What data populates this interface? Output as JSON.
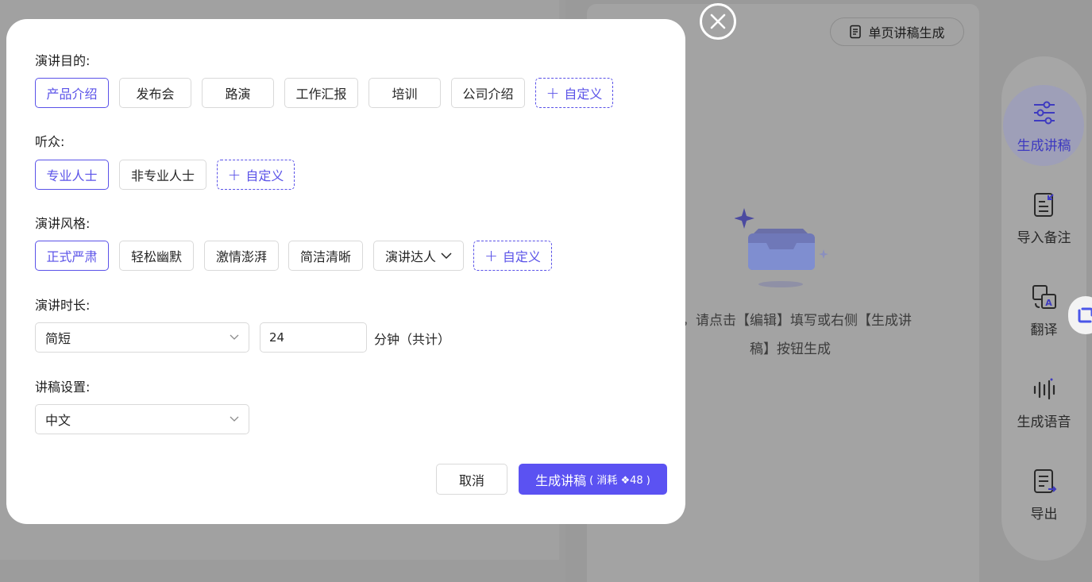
{
  "background": {
    "single_page_button": "单页讲稿生成",
    "empty_text_line1": "词，请点击【编辑】填写或右侧【生成讲",
    "empty_text_line2": "稿】按钮生成",
    "toolbar": [
      {
        "label": "生成讲稿",
        "icon": "sliders-icon",
        "active": true
      },
      {
        "label": "导入备注",
        "icon": "import-notes-icon",
        "active": false
      },
      {
        "label": "翻译",
        "icon": "translate-icon",
        "active": false
      },
      {
        "label": "生成语音",
        "icon": "audio-wave-icon",
        "active": false
      },
      {
        "label": "导出",
        "icon": "export-icon",
        "active": false
      }
    ]
  },
  "modal": {
    "purpose": {
      "label": "演讲目的:",
      "options": [
        "产品介绍",
        "发布会",
        "路演",
        "工作汇报",
        "培训",
        "公司介绍"
      ],
      "selected": "产品介绍",
      "custom": "自定义"
    },
    "audience": {
      "label": "听众:",
      "options": [
        "专业人士",
        "非专业人士"
      ],
      "selected": "专业人士",
      "custom": "自定义"
    },
    "style": {
      "label": "演讲风格:",
      "options": [
        "正式严肃",
        "轻松幽默",
        "激情澎湃",
        "简洁清晰"
      ],
      "dropdown": "演讲达人",
      "selected": "正式严肃",
      "custom": "自定义"
    },
    "duration": {
      "label": "演讲时长:",
      "select_value": "简短",
      "minutes": "24",
      "unit": "分钟（共计）"
    },
    "settings": {
      "label": "讲稿设置:",
      "language": "中文"
    },
    "cancel_label": "取消",
    "generate_label": "生成讲稿",
    "generate_cost": "( 消耗 ❖48 )"
  },
  "colors": {
    "accent": "#5a52e8",
    "primary_button": "#5b52f2"
  }
}
